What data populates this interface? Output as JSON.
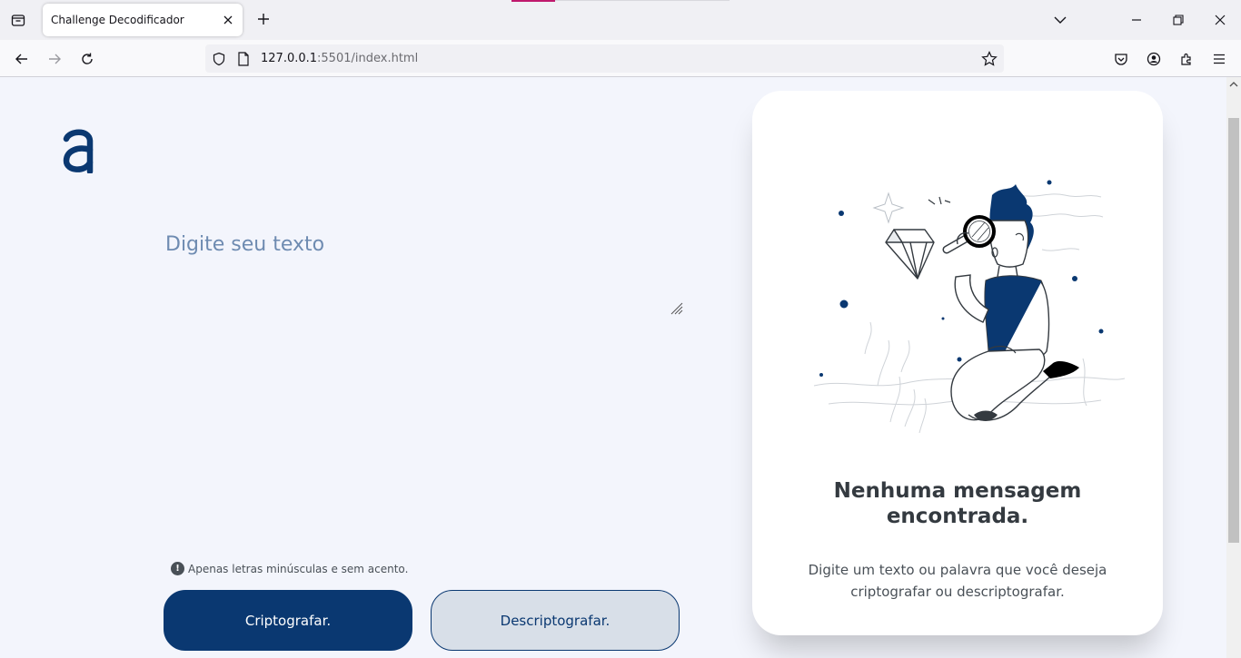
{
  "browser": {
    "tab_title": "Challenge Decodificador",
    "url_host": "127.0.0.1",
    "url_rest": ":5501/index.html"
  },
  "main": {
    "textarea_placeholder": "Digite seu texto",
    "hint_icon_glyph": "!",
    "hint_text": "Apenas letras minúsculas e sem acento.",
    "encrypt_button": "Criptografar.",
    "decrypt_button": "Descriptografar."
  },
  "output_panel": {
    "title": "Nenhuma mensagem encontrada.",
    "description": "Digite um texto ou palavra que você deseja criptografar ou descriptografar."
  },
  "colors": {
    "primary": "#0a3871",
    "background": "#f3f5fc",
    "decrypt_button_bg": "#d8dfe8",
    "card_bg": "#ffffff"
  },
  "icons": [
    "tab-list-icon",
    "close-icon",
    "plus-icon",
    "chevron-down-icon",
    "minimize-icon",
    "restore-icon",
    "back-arrow-icon",
    "forward-arrow-icon",
    "reload-icon",
    "shield-icon",
    "page-icon",
    "star-icon",
    "pocket-icon",
    "account-icon",
    "extensions-icon",
    "menu-icon",
    "logo-a-icon",
    "info-icon"
  ]
}
